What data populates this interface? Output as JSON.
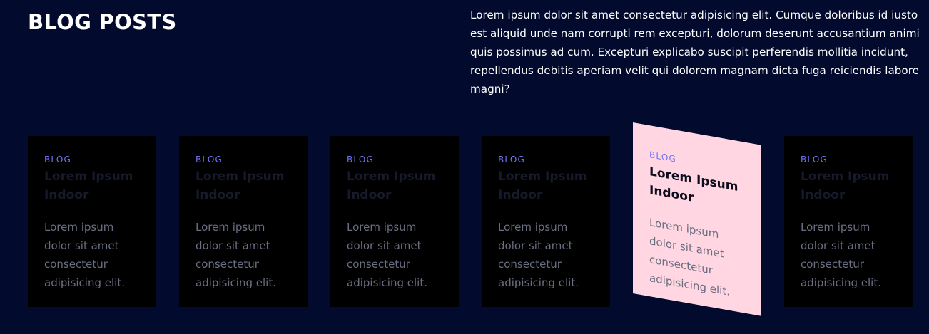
{
  "header": {
    "title": "BLOG POSTS",
    "intro": "Lorem ipsum dolor sit amet consectetur adipisicing elit. Cumque doloribus id iusto est aliquid unde nam corrupti rem excepturi, dolorum deserunt accusantium animi quis possimus ad cum. Excepturi explicabo suscipit perferendis mollitia incidunt, repellendus debitis aperiam velit qui dolorem magnam dicta fuga reiciendis labore magni?"
  },
  "cards": [
    {
      "tag": "BLOG",
      "title": "Lorem Ipsum Indoor",
      "text": "Lorem ipsum dolor sit amet consectetur adipisicing elit."
    },
    {
      "tag": "BLOG",
      "title": "Lorem Ipsum Indoor",
      "text": "Lorem ipsum dolor sit amet consectetur adipisicing elit."
    },
    {
      "tag": "BLOG",
      "title": "Lorem Ipsum Indoor",
      "text": "Lorem ipsum dolor sit amet consectetur adipisicing elit."
    },
    {
      "tag": "BLOG",
      "title": "Lorem Ipsum Indoor",
      "text": "Lorem ipsum dolor sit amet consectetur adipisicing elit."
    },
    {
      "tag": "BLOG",
      "title": "Lorem Ipsum Indoor",
      "text": "Lorem ipsum dolor sit amet consectetur adipisicing elit."
    },
    {
      "tag": "BLOG",
      "title": "Lorem Ipsum Indoor",
      "text": "Lorem ipsum dolor sit amet consectetur adipisicing elit."
    }
  ],
  "colors": {
    "background": "#020a2e",
    "card": "#000000",
    "card_active": "#ffd6e1",
    "accent": "#6f73f5"
  }
}
